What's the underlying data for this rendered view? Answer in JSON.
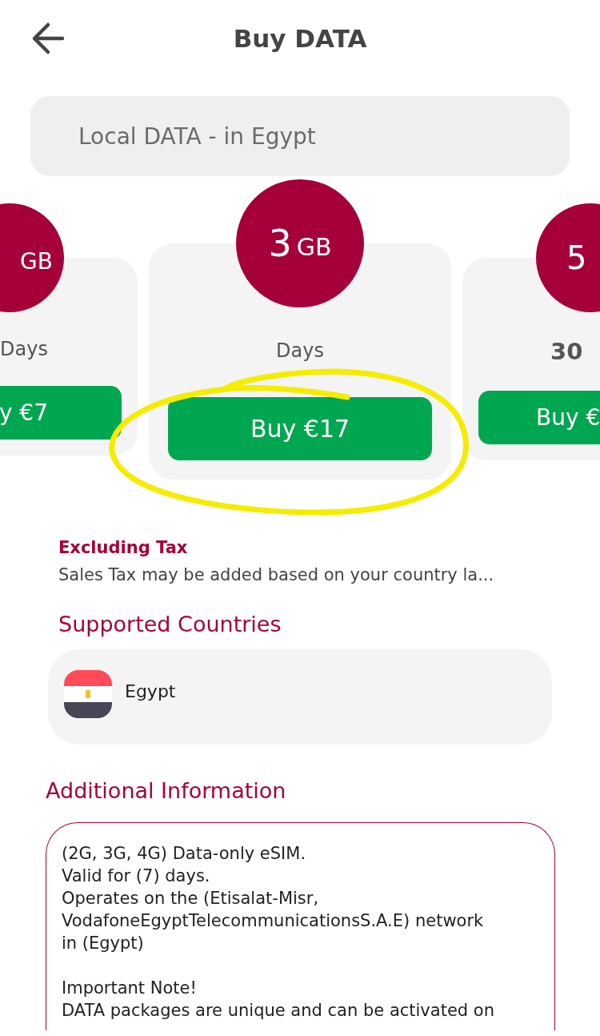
{
  "header": {
    "title": "Buy DATA"
  },
  "search": {
    "placeholder": "Local DATA - in Egypt"
  },
  "plans": [
    {
      "kind": "left-cut",
      "unit": "GB",
      "validity": "Days",
      "button": "y €7"
    },
    {
      "kind": "full",
      "size": "3",
      "unit": "GB",
      "validity": "Days",
      "button": "Buy €17"
    },
    {
      "kind": "right-cut",
      "size": "5",
      "validity": "**30**",
      "button": "Buy €"
    }
  ],
  "tax": {
    "title": "Excluding Tax",
    "note": "Sales Tax may be added based on your country la..."
  },
  "supported": {
    "title": "Supported Countries",
    "countries": [
      {
        "name": "Egypt"
      }
    ]
  },
  "additional": {
    "title": "Additional Information",
    "text": "(2G, 3G, 4G) Data-only eSIM.\nValid for (7) days.\nOperates on the (Etisalat-Misr,\nVodafoneEgyptTelecommunicationsS.A.E) network\nin (Egypt)\n\nImportant Note!\nDATA packages are unique and can be activated on"
  }
}
